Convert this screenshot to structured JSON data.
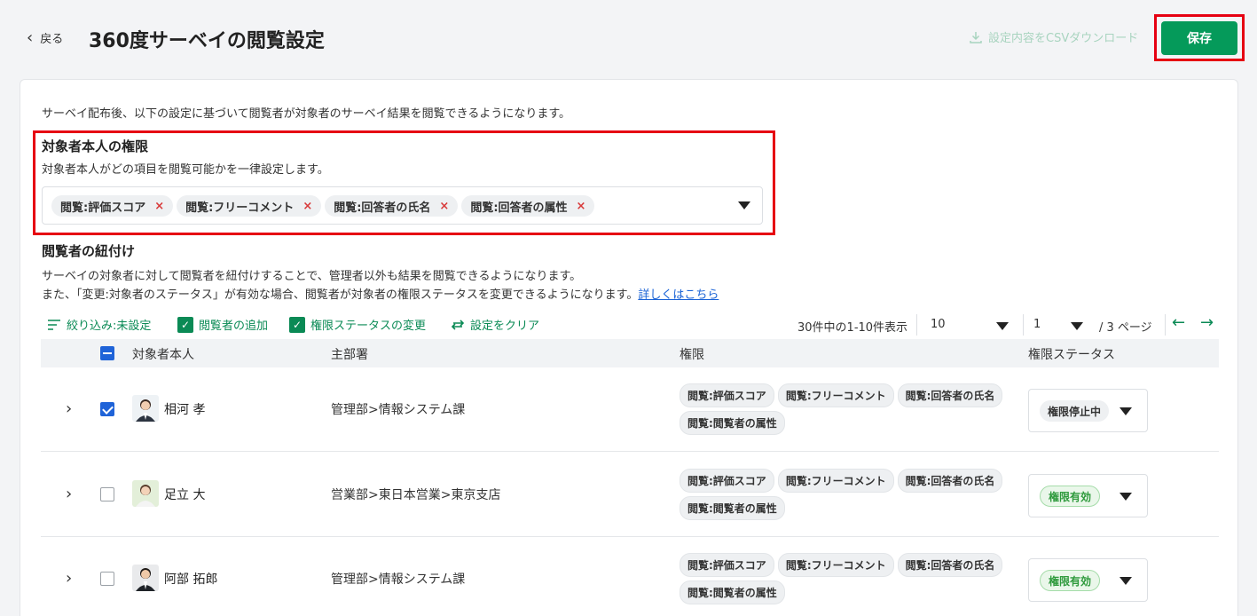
{
  "header": {
    "back_label": "戻る",
    "title": "360度サーベイの閲覧設定",
    "csv_label": "設定内容をCSVダウンロード",
    "save_label": "保存"
  },
  "intro": "サーベイ配布後、以下の設定に基づいて閲覧者が対象者のサーベイ結果を閲覧できるようになります。",
  "self_permission": {
    "title": "対象者本人の権限",
    "description": "対象者本人がどの項目を閲覧可能かを一律設定します。",
    "tags": [
      "閲覧:評価スコア",
      "閲覧:フリーコメント",
      "閲覧:回答者の氏名",
      "閲覧:回答者の属性"
    ]
  },
  "linking": {
    "title": "閲覧者の紐付け",
    "desc1": "サーベイの対象者に対して閲覧者を紐付けすることで、管理者以外も結果を閲覧できるようになります。",
    "desc2": "また、「変更:対象者のステータス」が有効な場合、閲覧者が対象者の権限ステータスを変更できるようになります。",
    "link": "詳しくはこちら"
  },
  "toolbar": {
    "filter": "絞り込み:未設定",
    "add_viewer": "閲覧者の追加",
    "change_status": "権限ステータスの変更",
    "clear": "設定をクリア",
    "count": "30件中の1-10件表示",
    "per_page": "10",
    "page": "1",
    "page_total": "/ 3 ページ"
  },
  "table": {
    "headers": [
      "対象者本人",
      "主部署",
      "権限",
      "権限ステータス"
    ],
    "rows": [
      {
        "name": "相河 孝",
        "dept": "管理部>情報システム課",
        "perms": [
          "閲覧:評価スコア",
          "閲覧:フリーコメント",
          "閲覧:回答者の氏名",
          "閲覧:閲覧者の属性"
        ],
        "status": "権限停止中",
        "checked": true
      },
      {
        "name": "足立 大",
        "dept": "営業部>東日本営業>東京支店",
        "perms": [
          "閲覧:評価スコア",
          "閲覧:フリーコメント",
          "閲覧:回答者の氏名",
          "閲覧:閲覧者の属性"
        ],
        "status": "権限有効",
        "checked": false
      },
      {
        "name": "阿部 拓郎",
        "dept": "管理部>情報システム課",
        "perms": [
          "閲覧:評価スコア",
          "閲覧:フリーコメント",
          "閲覧:回答者の氏名",
          "閲覧:閲覧者の属性"
        ],
        "status": "権限有効",
        "checked": false
      }
    ]
  },
  "colors": {
    "accent": "#059a5a",
    "highlight": "#e60012",
    "link": "#1a63d6"
  }
}
